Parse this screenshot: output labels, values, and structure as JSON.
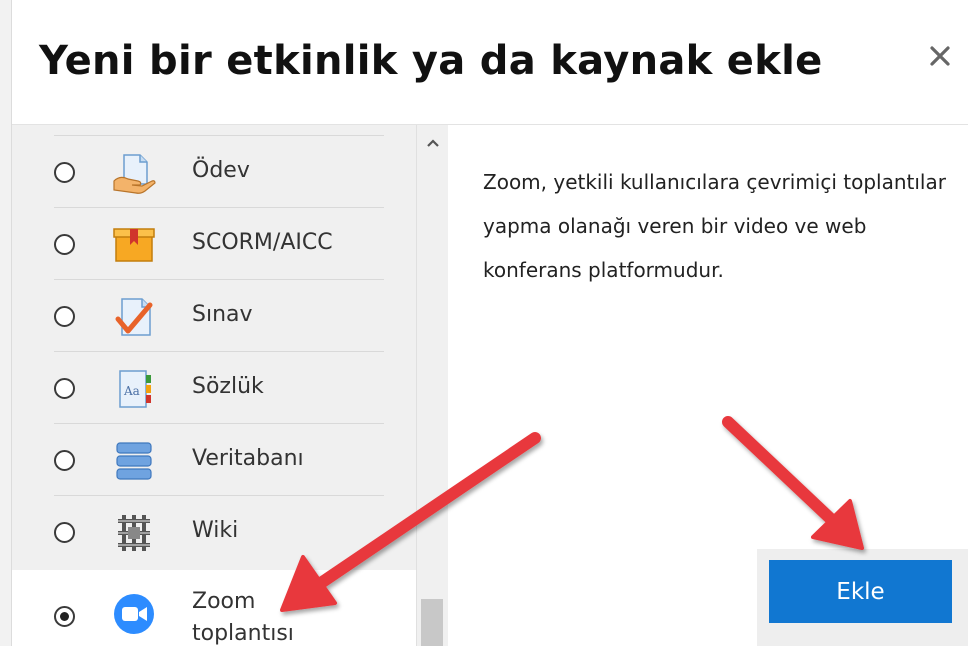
{
  "dialog": {
    "title": "Yeni bir etkinlik ya da kaynak ekle",
    "close_label": "×"
  },
  "activities": [
    {
      "label": "Ödev",
      "icon": "assignment-icon",
      "selected": false
    },
    {
      "label": "SCORM/AICC",
      "icon": "scorm-package-icon",
      "selected": false
    },
    {
      "label": "Sınav",
      "icon": "quiz-icon",
      "selected": false
    },
    {
      "label": "Sözlük",
      "icon": "glossary-icon",
      "selected": false
    },
    {
      "label": "Veritabanı",
      "icon": "database-icon",
      "selected": false
    },
    {
      "label": "Wiki",
      "icon": "wiki-icon",
      "selected": false
    },
    {
      "label": "Zoom toplantısı",
      "icon": "zoom-camera-icon",
      "selected": true
    }
  ],
  "description": "Zoom, yetkili kullanıcılara çevrimiçi toplantılar yapma olanağı veren bir video ve web konferans platformudur.",
  "add_button_label": "Ekle",
  "colors": {
    "accent": "#1177d1",
    "arrow": "#e8383d",
    "zoom": "#2d8cff",
    "panel": "#f0f0f0"
  }
}
